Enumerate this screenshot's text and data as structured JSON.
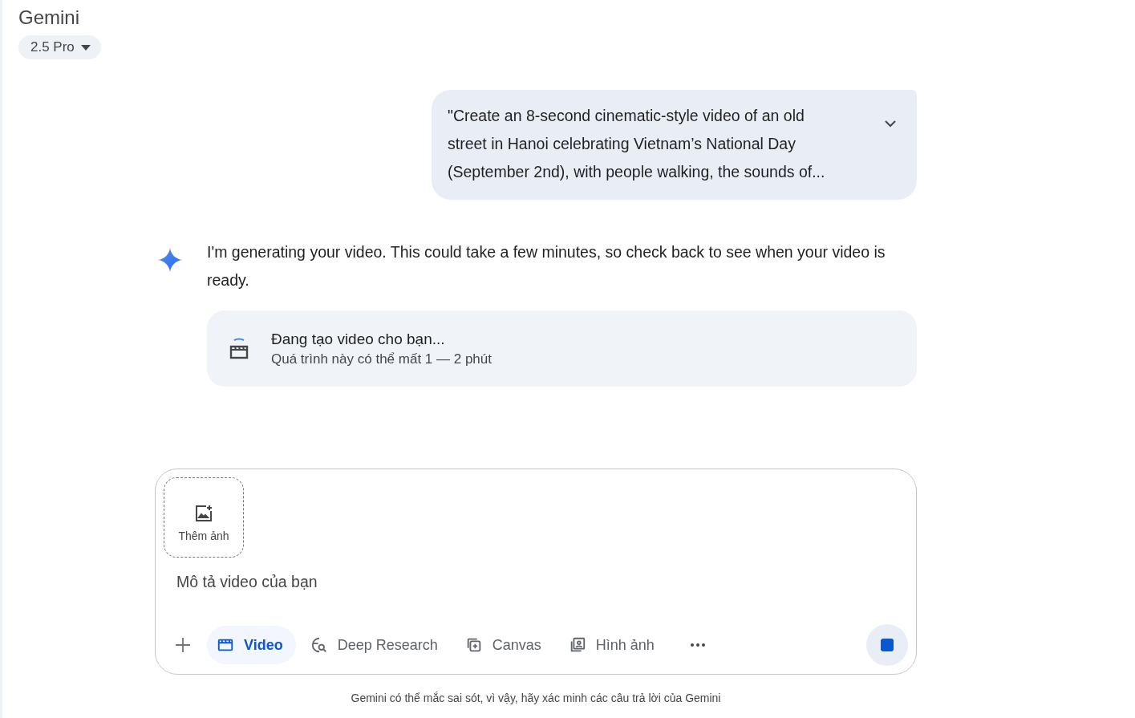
{
  "header": {
    "title": "Gemini",
    "model": "2.5 Pro"
  },
  "user_message": {
    "text": "\"Create an 8-second cinematic-style video of an old street in Hanoi celebrating Vietnam’s National Day (September 2nd), with people walking, the sounds of...",
    "expanded": false
  },
  "response": {
    "text": "I'm generating your video. This could take a few minutes, so check back to see when your video is ready.",
    "status_card": {
      "title": "Đang tạo video cho bạn...",
      "subtitle": "Quá trình này có thể mất 1 — 2 phút"
    }
  },
  "composer": {
    "attach_label": "Thêm ảnh",
    "placeholder": "Mô tả video của bạn",
    "tools": [
      {
        "label": "Video",
        "selected": true
      },
      {
        "label": "Deep Research",
        "selected": false
      },
      {
        "label": "Canvas",
        "selected": false
      },
      {
        "label": "Hình ảnh",
        "selected": false
      }
    ]
  },
  "disclaimer": "Gemini có thể mắc sai sót, vì vậy, hãy xác minh các câu trả lời của Gemini"
}
